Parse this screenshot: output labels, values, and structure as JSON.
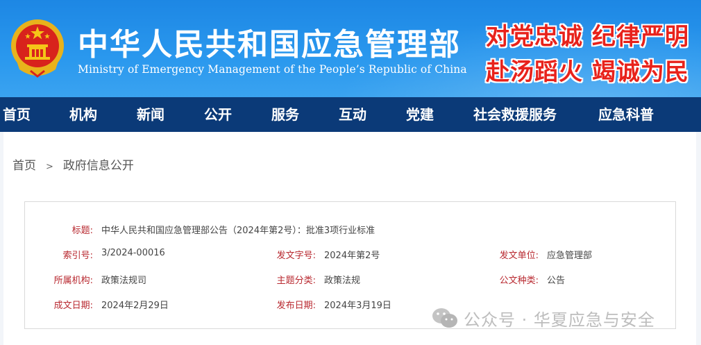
{
  "header": {
    "ministry_cn": "中华人民共和国应急管理部",
    "ministry_en": "Ministry of Emergency Management of the People’s Republic of China",
    "slogan_line1": "对党忠诚 纪律严明",
    "slogan_line2": "赴汤蹈火 竭诚为民",
    "slogan_color": "#e8221b",
    "header_blue": "#2a98ee"
  },
  "nav": {
    "color": "#0b3a78",
    "items": [
      "首页",
      "机构",
      "新闻",
      "公开",
      "服务",
      "互动",
      "党建",
      "社会救援服务",
      "应急科普"
    ]
  },
  "breadcrumb": {
    "home": "首页",
    "separator": ">",
    "current": "政府信息公开"
  },
  "info": {
    "title_label": "标题:",
    "title_value": "中华人民共和国应急管理部公告（2024年第2号）：批准3项行业标准",
    "index_label": "索引号:",
    "index_value": "3/2024-00016",
    "doc_no_label": "发文字号:",
    "doc_no_value": "2024年第2号",
    "issuer_label": "发文单位:",
    "issuer_value": "应急管理部",
    "org_label": "所属机构:",
    "org_value": "政策法规司",
    "topic_label": "主题分类:",
    "topic_value": "政策法规",
    "type_label": "公文种类:",
    "type_value": "公告",
    "date_label": "成文日期:",
    "date_value": "2024年2月29日",
    "pub_label": "发布日期:",
    "pub_value": "2024年3月19日",
    "label_color": "#b8282f"
  },
  "watermark": {
    "text": "公众号 · 华夏应急与安全",
    "icon": "wechat-icon"
  }
}
